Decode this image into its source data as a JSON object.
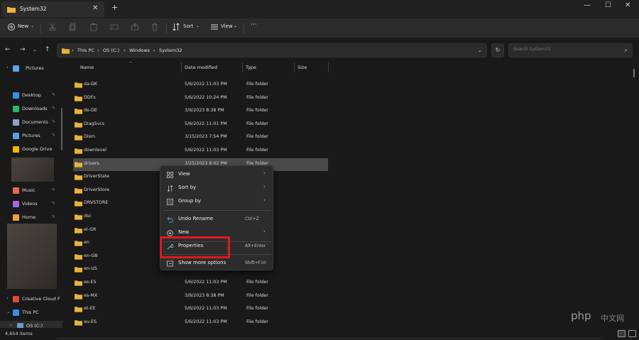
{
  "window": {
    "tab_title": "System32",
    "new_tab_glyph": "+",
    "close_tab_glyph": "✕",
    "controls": [
      "—",
      "☐",
      "✕"
    ]
  },
  "toolbar": {
    "new_label": "New",
    "sort_label": "Sort",
    "view_label": "View",
    "more_label": "···",
    "icons": [
      "cut-icon",
      "copy-icon",
      "paste-icon",
      "rename-icon",
      "share-icon",
      "delete-icon"
    ]
  },
  "address": {
    "crumbs": [
      "This PC",
      "OS (C:)",
      "Windows",
      "System32"
    ],
    "search_placeholder": "Search System32"
  },
  "sidebar": {
    "items": [
      {
        "label": "Pictures",
        "icon": "pictures-icon",
        "color": "#5aa0e6"
      },
      {
        "label": "Desktop",
        "icon": "desktop-icon",
        "color": "#3a8ee6"
      },
      {
        "label": "Downloads",
        "icon": "downloads-icon",
        "color": "#2fb36b"
      },
      {
        "label": "Documents",
        "icon": "documents-icon",
        "color": "#8aa4c8"
      },
      {
        "label": "Pictures",
        "icon": "pictures-icon",
        "color": "#5aa0e6"
      },
      {
        "label": "Google Drive",
        "icon": "google-drive-icon",
        "color": "#f4b400"
      },
      {
        "label": "Music",
        "icon": "music-icon",
        "color": "#e36a55"
      },
      {
        "label": "Videos",
        "icon": "videos-icon",
        "color": "#9a6ce0"
      },
      {
        "label": "Home",
        "icon": "home-icon",
        "color": "#e8a33a"
      },
      {
        "label": "Creative Cloud F",
        "icon": "creative-cloud-icon",
        "color": "#da4a3c"
      },
      {
        "label": "This PC",
        "icon": "this-pc-icon",
        "color": "#3a8ee6"
      },
      {
        "label": "OS (C:)",
        "icon": "drive-icon",
        "color": "#6b9bd1"
      }
    ]
  },
  "columns": {
    "name": "Name",
    "date": "Date modified",
    "type": "Type",
    "size": "Size"
  },
  "files": [
    {
      "name": "da-DK",
      "date": "5/6/2022 11:03 PM",
      "type": "File folder"
    },
    {
      "name": "DDFs",
      "date": "5/6/2022 10:24 PM",
      "type": "File folder"
    },
    {
      "name": "de-DE",
      "date": "3/9/2023 8:38 PM",
      "type": "File folder"
    },
    {
      "name": "DiagSvcs",
      "date": "5/6/2022 11:01 PM",
      "type": "File folder"
    },
    {
      "name": "Dism",
      "date": "3/15/2023 7:54 PM",
      "type": "File folder"
    },
    {
      "name": "downlevel",
      "date": "5/6/2022 11:03 PM",
      "type": "File folder"
    },
    {
      "name": "drivers",
      "date": "3/25/2023 8:02 PM",
      "type": "File folder"
    },
    {
      "name": "DriverState",
      "date": "",
      "type": ""
    },
    {
      "name": "DriverStore",
      "date": "",
      "type": ""
    },
    {
      "name": "DRVSTORE",
      "date": "",
      "type": ""
    },
    {
      "name": "dsc",
      "date": "",
      "type": ""
    },
    {
      "name": "el-GR",
      "date": "",
      "type": ""
    },
    {
      "name": "en",
      "date": "",
      "type": ""
    },
    {
      "name": "en-GB",
      "date": "",
      "type": ""
    },
    {
      "name": "en-US",
      "date": "",
      "type": ""
    },
    {
      "name": "es-ES",
      "date": "5/6/2022 11:03 PM",
      "type": "File folder"
    },
    {
      "name": "es-MX",
      "date": "3/9/2023 8:38 PM",
      "type": "File folder"
    },
    {
      "name": "et-EE",
      "date": "5/6/2022 11:03 PM",
      "type": "File folder"
    },
    {
      "name": "eu-ES",
      "date": "5/6/2022 11:03 PM",
      "type": "File folder"
    }
  ],
  "context_menu": {
    "items": [
      {
        "label": "View",
        "shortcut": "",
        "submenu": true,
        "icon": "grid-icon"
      },
      {
        "label": "Sort by",
        "shortcut": "",
        "submenu": true,
        "icon": "sort-icon"
      },
      {
        "label": "Group by",
        "shortcut": "",
        "submenu": true,
        "icon": "group-icon"
      },
      {
        "label": "Undo Rename",
        "shortcut": "Ctrl+Z",
        "submenu": false,
        "icon": "undo-icon"
      },
      {
        "label": "New",
        "shortcut": "",
        "submenu": true,
        "icon": "new-icon"
      },
      {
        "label": "Properties",
        "shortcut": "Alt+Enter",
        "submenu": false,
        "icon": "wrench-icon"
      },
      {
        "label": "Show more options",
        "shortcut": "Shift+F10",
        "submenu": false,
        "icon": "more-options-icon"
      }
    ],
    "highlight_color": "#e0191b"
  },
  "status": {
    "item_count": "4,654 items"
  },
  "watermark": {
    "brand": "php",
    "suffix": "中文网"
  },
  "colors": {
    "folder": "#e8b43a",
    "selected_row": "#4a4a4a"
  }
}
